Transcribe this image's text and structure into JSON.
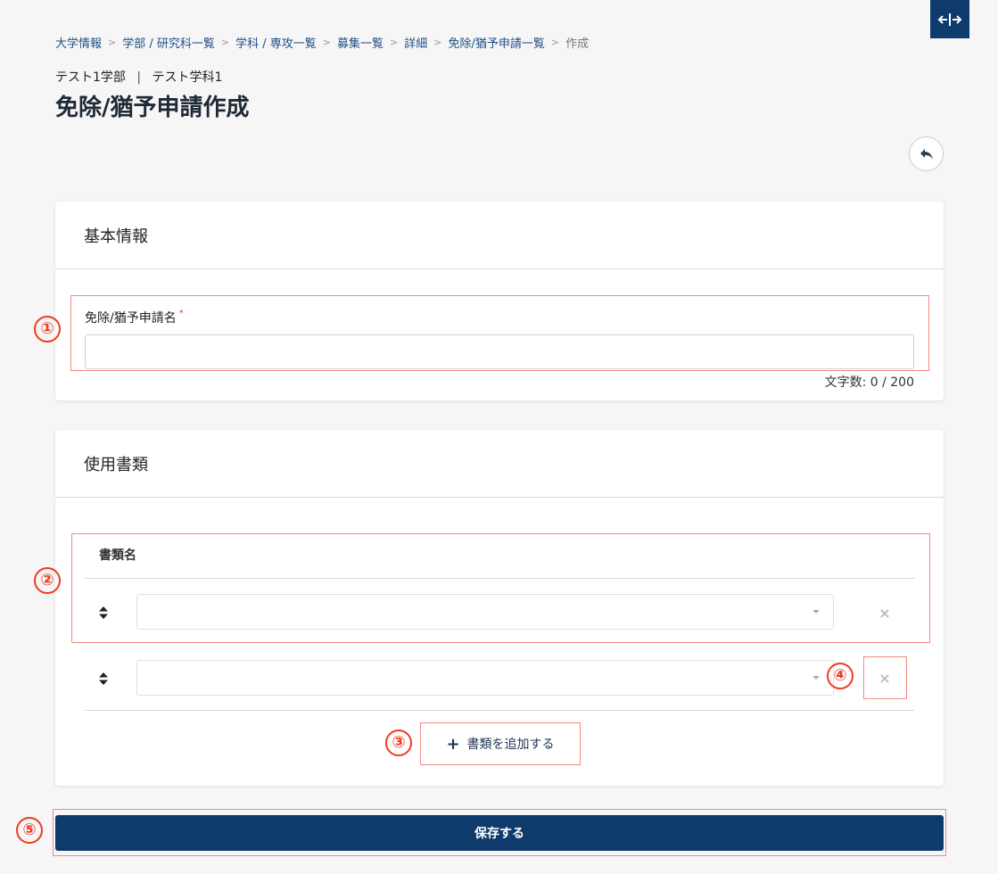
{
  "breadcrumb": [
    "大学情報",
    "学部 / 研究科一覧",
    "学科 / 専攻一覧",
    "募集一覧",
    "詳細",
    "免除/猶予申請一覧",
    "作成"
  ],
  "breadcrumb_separator": ">",
  "header": {
    "faculty": "テスト1学部",
    "department": "テスト学科1",
    "divider": "|",
    "title": "免除/猶予申請作成"
  },
  "basic_info": {
    "heading": "基本情報",
    "name_label": "免除/猶予申請名",
    "required_mark": "*",
    "name_value": "",
    "counter": "文字数: 0 / 200"
  },
  "documents": {
    "heading": "使用書類",
    "column_header": "書類名",
    "rows": [
      {
        "selected": ""
      },
      {
        "selected": ""
      }
    ],
    "add_label": "書類を追加する"
  },
  "save_label": "保存する",
  "markers": [
    "①",
    "②",
    "③",
    "④",
    "⑤"
  ],
  "colors": {
    "primary": "#0f3b6c",
    "highlight_box": "#f08c7f",
    "marker": "#ef3a1f"
  },
  "icons": {
    "expand": "expand-horizontal-icon",
    "back": "reply-back-icon",
    "sort": "sort-handle-icon",
    "remove": "close-icon",
    "add": "plus-icon"
  }
}
